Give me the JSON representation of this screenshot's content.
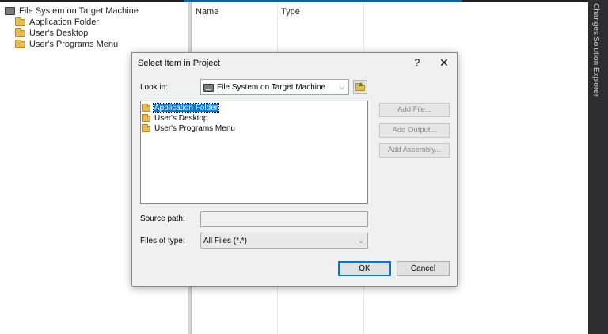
{
  "tree": {
    "root": "File System on Target Machine",
    "children": [
      "Application Folder",
      "User's Desktop",
      "User's Programs Menu"
    ]
  },
  "list": {
    "columns": [
      "Name",
      "Type"
    ]
  },
  "side_tabs": [
    "Changes",
    "Solution Explorer"
  ],
  "dialog": {
    "title": "Select Item in Project",
    "help_glyph": "?",
    "close_glyph": "✕",
    "look_in_label": "Look in:",
    "look_in_value": "File System on Target Machine",
    "items": [
      {
        "label": "Application Folder",
        "selected": true
      },
      {
        "label": "User's Desktop",
        "selected": false
      },
      {
        "label": "User's Programs Menu",
        "selected": false
      }
    ],
    "buttons_side": [
      "Add File...",
      "Add Output...",
      "Add Assembly..."
    ],
    "source_path_label": "Source path:",
    "source_path_value": "",
    "files_of_type_label": "Files of type:",
    "files_of_type_value": "All Files (*.*)",
    "ok_label": "OK",
    "cancel_label": "Cancel"
  },
  "icons": {
    "drive": "drive-icon",
    "folder": "folder-icon",
    "up": "up-folder-icon",
    "dropdown": "chevron-down-icon"
  },
  "colors": {
    "selection": "#0078d7",
    "dialog_bg": "#f0f0f0",
    "side_strip": "#2d2d30",
    "accent": "#0e639c"
  }
}
